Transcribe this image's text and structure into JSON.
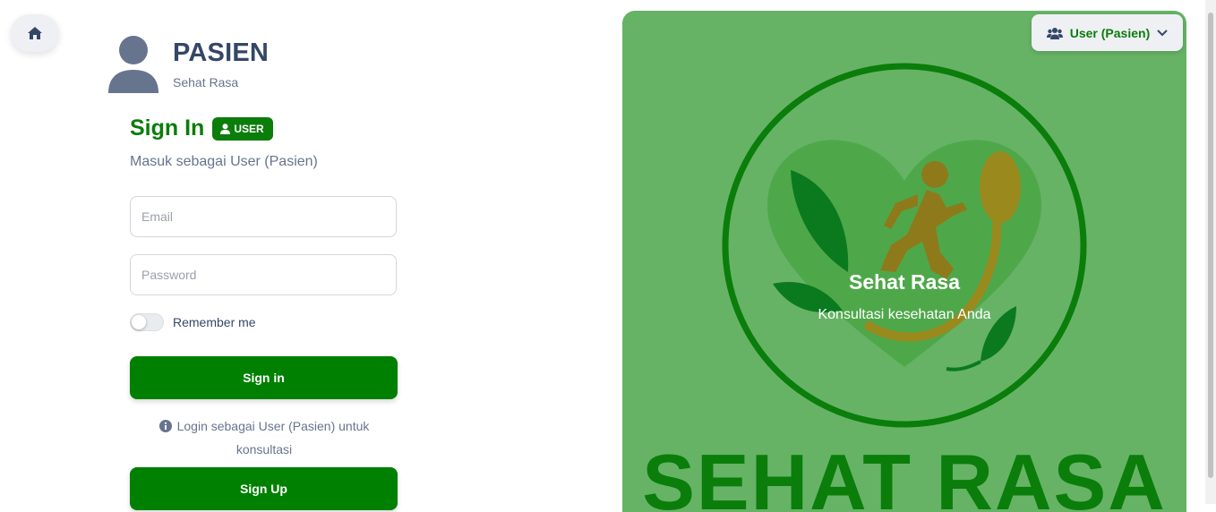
{
  "home": {
    "icon": "home-icon"
  },
  "brand": {
    "title": "PASIEN",
    "subtitle": "Sehat Rasa"
  },
  "signin": {
    "title": "Sign In",
    "badge": "USER",
    "subtitle": "Masuk sebagai User (Pasien)",
    "email_placeholder": "Email",
    "password_placeholder": "Password",
    "remember_label": "Remember me",
    "remember_checked": false,
    "signin_button": "Sign in",
    "info_text": "Login sebagai User (Pasien) untuk konsultasi",
    "signup_button": "Sign Up"
  },
  "role_dropdown": {
    "label": "User (Pasien)",
    "icon": "users-icon"
  },
  "panel": {
    "title": "Sehat Rasa",
    "subtitle": "Konsultasi kesehatan Anda",
    "logo_text": "SEHAT RASA"
  },
  "colors": {
    "accent": "#0a7d0a",
    "button": "#008000",
    "panel_bg": "#66b366",
    "text_dark": "#344767",
    "text_muted": "#67748e"
  }
}
